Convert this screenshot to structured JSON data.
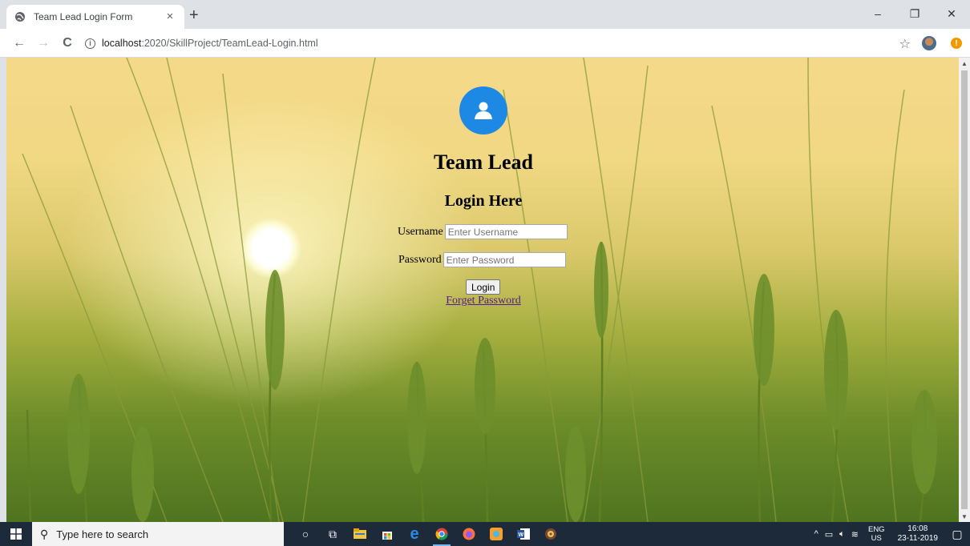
{
  "browser": {
    "tab_title": "Team Lead Login Form",
    "tab_close": "×",
    "new_tab": "+",
    "url_host": "localhost",
    "url_path": ":2020/SkillProject/TeamLead-Login.html",
    "window_controls": {
      "minimize": "–",
      "restore": "❐",
      "close": "✕"
    },
    "nav": {
      "back": "←",
      "forward": "→",
      "reload": "C"
    },
    "bookmark_icon": "☆",
    "alert": "!"
  },
  "form": {
    "title": "Team Lead",
    "subtitle": "Login Here",
    "username_label": "Username",
    "username_placeholder": "Enter Username",
    "password_label": "Password",
    "password_placeholder": "Enter Password",
    "login_label": "Login",
    "forgot_label": "Forget Password",
    "avatar_color": "#1e88e5"
  },
  "taskbar": {
    "search_placeholder": "Type here to search",
    "lang_top": "ENG",
    "lang_bottom": "US",
    "time": "16:08",
    "date": "23-11-2019"
  }
}
